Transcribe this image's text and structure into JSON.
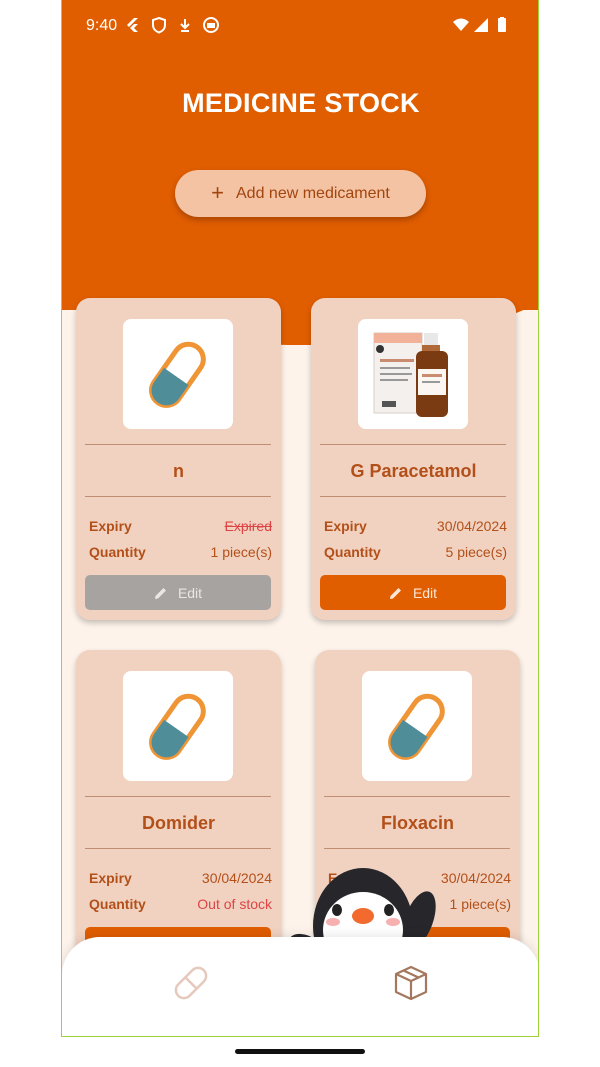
{
  "status_bar": {
    "time": "9:40"
  },
  "header": {
    "title": "MEDICINE STOCK",
    "add_button_label": "Add new medicament"
  },
  "labels": {
    "expiry": "Expiry",
    "quantity": "Quantity",
    "edit": "Edit"
  },
  "medicines": [
    {
      "name": "n",
      "expiry": "Expired",
      "quantity": "1 piece(s)",
      "image": "pill-icon",
      "edit_enabled": false
    },
    {
      "name": "G Paracetamol",
      "expiry": "30/04/2024",
      "quantity": "5 piece(s)",
      "image": "paracetamol-bottle-photo",
      "edit_enabled": true
    },
    {
      "name": "Domider",
      "expiry": "30/04/2024",
      "quantity": "Out of stock",
      "image": "pill-icon",
      "edit_enabled": true
    },
    {
      "name": "Floxacin",
      "expiry": "30/04/2024",
      "quantity": "1 piece(s)",
      "image": "pill-icon",
      "edit_enabled": true
    }
  ],
  "bottom_nav": {
    "items": [
      "pill-icon",
      "box-icon"
    ]
  },
  "colors": {
    "primary": "#e05d00",
    "card": "#f1d2c1",
    "accent_text": "#b35019",
    "background": "#fdf3ea"
  }
}
